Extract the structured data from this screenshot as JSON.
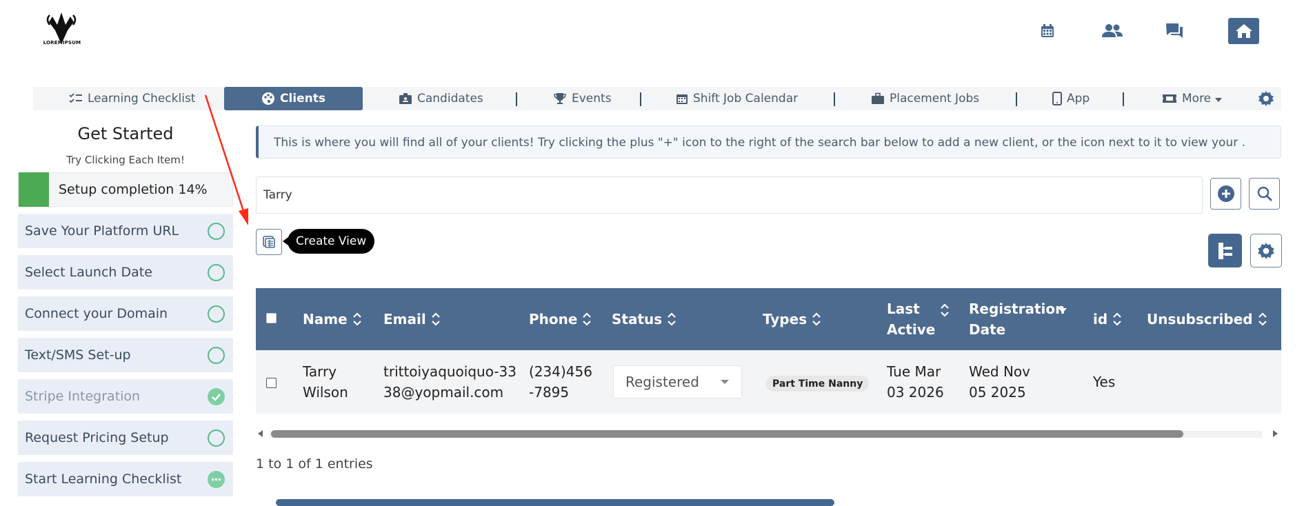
{
  "header": {
    "logo_text": "LOREMIPSUM",
    "icons": [
      "calendar-icon",
      "people-icon",
      "chat-icon",
      "home-icon"
    ]
  },
  "tabs": [
    {
      "label": "Learning Checklist",
      "icon": "checklist-icon"
    },
    {
      "label": "Clients",
      "icon": "palette-icon",
      "active": true
    },
    {
      "label": "Candidates",
      "icon": "badge-icon"
    },
    {
      "label": "Events",
      "icon": "trophy-icon"
    },
    {
      "label": "Shift Job Calendar",
      "icon": "calendar-icon"
    },
    {
      "label": "Placement Jobs",
      "icon": "briefcase-icon"
    },
    {
      "label": "App",
      "icon": "phone-icon"
    },
    {
      "label": "More",
      "icon": "ticket-icon"
    }
  ],
  "sidebar": {
    "title": "Get Started",
    "subtitle": "Try Clicking Each Item!",
    "progress_label": "Setup completion 14%",
    "progress": 0.14,
    "items": [
      {
        "label": "Save Your Platform URL",
        "status": "open"
      },
      {
        "label": "Select Launch Date",
        "status": "open"
      },
      {
        "label": "Connect your Domain",
        "status": "open"
      },
      {
        "label": "Text/SMS Set-up",
        "status": "open"
      },
      {
        "label": "Stripe Integration",
        "status": "done"
      },
      {
        "label": "Request Pricing Setup",
        "status": "open"
      },
      {
        "label": "Start Learning Checklist",
        "status": "more"
      }
    ]
  },
  "info": {
    "text": "This is where you will find all of your clients! Try clicking the plus \"+\" icon to the right of the search bar below to add a new client, or the icon next to it to view your ."
  },
  "search": {
    "value": "Tarry"
  },
  "tooltip": {
    "text": "Create View"
  },
  "table": {
    "columns": [
      "Name",
      "Email",
      "Phone",
      "Status",
      "Types",
      "Last Active",
      "Registration Date",
      "id",
      "Unsubscribed"
    ],
    "row": {
      "name": "Tarry Wilson",
      "email": "trittoiyaquoiquo-3338@yopmail.com",
      "phone": "(234)456-7895",
      "status": "Registered",
      "type": "Part Time Nanny",
      "last_active": "Tue Mar 03 2026",
      "registration_date": "Wed Nov 05 2025",
      "unsubscribed": "Yes"
    }
  },
  "footer": {
    "entries": "1 to 1 of 1 entries"
  }
}
